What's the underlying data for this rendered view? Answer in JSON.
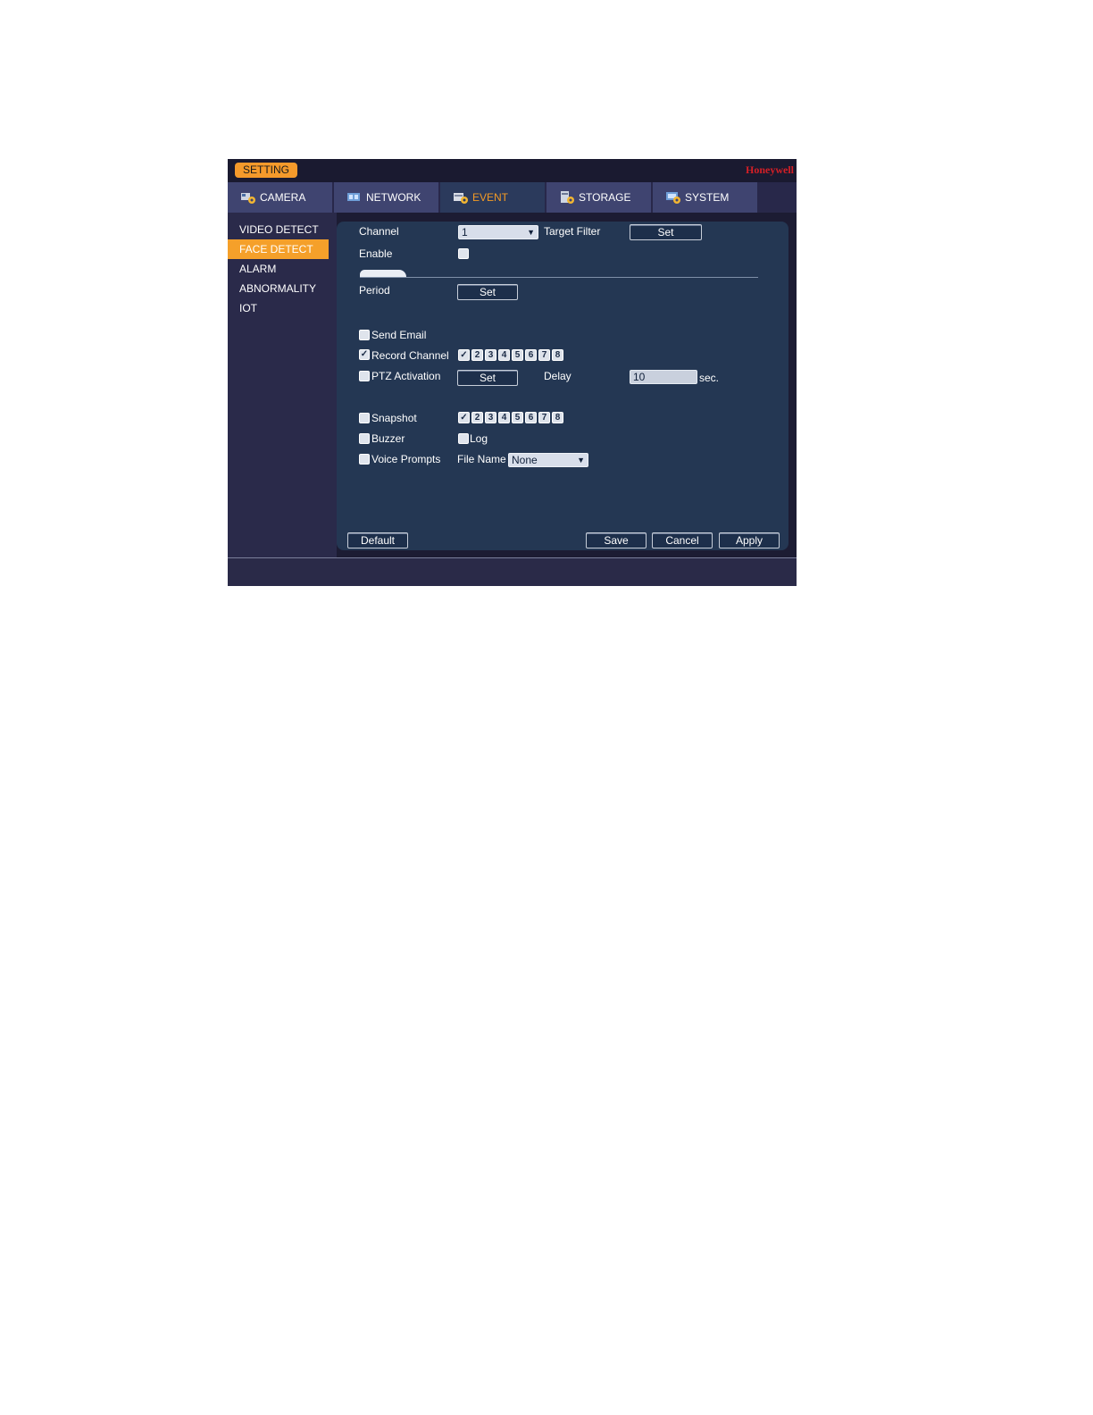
{
  "header": {
    "setting_label": "SETTING",
    "brand": "Honeywell"
  },
  "tabs": [
    {
      "label": "CAMERA",
      "icon": "camera-gear-icon"
    },
    {
      "label": "NETWORK",
      "icon": "network-gear-icon"
    },
    {
      "label": "EVENT",
      "icon": "event-gear-icon",
      "active": true
    },
    {
      "label": "STORAGE",
      "icon": "storage-gear-icon"
    },
    {
      "label": "SYSTEM",
      "icon": "system-gear-icon"
    }
  ],
  "sidebar": {
    "items": [
      {
        "label": "VIDEO DETECT"
      },
      {
        "label": "FACE DETECT",
        "active": true
      },
      {
        "label": "ALARM"
      },
      {
        "label": "ABNORMALITY"
      },
      {
        "label": "IOT"
      }
    ]
  },
  "form": {
    "channel_label": "Channel",
    "channel_value": "1",
    "target_filter_label": "Target Filter",
    "target_filter_button": "Set",
    "enable_label": "Enable",
    "enable_checked": false,
    "period_label": "Period",
    "period_button": "Set",
    "send_email_label": "Send Email",
    "send_email_checked": false,
    "record_channel_label": "Record Channel",
    "record_channel_checked": true,
    "record_channels": [
      "1",
      "2",
      "3",
      "4",
      "5",
      "6",
      "7",
      "8"
    ],
    "record_channels_checked": [
      "1"
    ],
    "ptz_label": "PTZ Activation",
    "ptz_checked": false,
    "ptz_button": "Set",
    "delay_label": "Delay",
    "delay_value": "10",
    "delay_unit": "sec.",
    "snapshot_label": "Snapshot",
    "snapshot_checked": false,
    "snapshot_channels": [
      "1",
      "2",
      "3",
      "4",
      "5",
      "6",
      "7",
      "8"
    ],
    "snapshot_channels_checked": [
      "1"
    ],
    "buzzer_label": "Buzzer",
    "buzzer_checked": false,
    "log_label": "Log",
    "log_checked": false,
    "voice_label": "Voice Prompts",
    "voice_checked": false,
    "file_name_label": "File Name",
    "file_name_value": "None"
  },
  "footer": {
    "default": "Default",
    "save": "Save",
    "cancel": "Cancel",
    "apply": "Apply"
  },
  "colors": {
    "accent": "#f5a02a",
    "brand": "#d41f26",
    "panel": "#243753"
  }
}
